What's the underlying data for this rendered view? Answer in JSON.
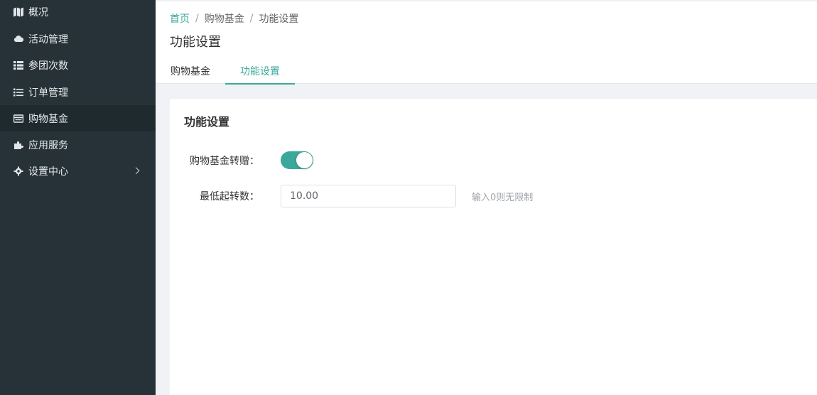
{
  "sidebar": {
    "items": [
      {
        "label": "概况",
        "icon": "map-icon"
      },
      {
        "label": "活动管理",
        "icon": "cloud-icon"
      },
      {
        "label": "参团次数",
        "icon": "table-list-icon"
      },
      {
        "label": "订单管理",
        "icon": "list-icon"
      },
      {
        "label": "购物基金",
        "icon": "card-icon"
      },
      {
        "label": "应用服务",
        "icon": "puzzle-icon"
      },
      {
        "label": "设置中心",
        "icon": "gear-icon"
      }
    ]
  },
  "breadcrumb": {
    "home": "首页",
    "sep1": "/",
    "parent": "购物基金",
    "sep2": "/",
    "current": "功能设置"
  },
  "page": {
    "title": "功能设置"
  },
  "tabs": [
    {
      "label": "购物基金"
    },
    {
      "label": "功能设置"
    }
  ],
  "card": {
    "title": "功能设置",
    "transfer_label": "购物基金转赠：",
    "transfer_enabled": true,
    "min_label": "最低起转数：",
    "min_value": "10.00",
    "min_hint": "输入0则无限制"
  },
  "colors": {
    "accent": "#3aa89b",
    "sidebar_bg": "#263238"
  }
}
